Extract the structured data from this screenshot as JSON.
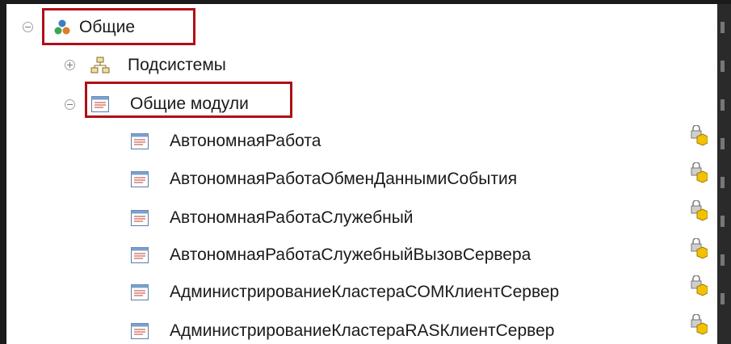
{
  "tree": {
    "root": {
      "label": "Общие",
      "icon": "common-objects-icon",
      "expander": "collapse"
    },
    "subsystems": {
      "label": "Подсистемы",
      "icon": "subsystems-icon",
      "expander": "expand"
    },
    "common_modules": {
      "label": "Общие модули",
      "icon": "module-icon",
      "expander": "collapse"
    },
    "modules": [
      {
        "label": "АвтономнаяРабота"
      },
      {
        "label": "АвтономнаяРаботаОбменДаннымиСобытия"
      },
      {
        "label": "АвтономнаяРаботаСлужебный"
      },
      {
        "label": "АвтономнаяРаботаСлужебныйВызовСервера"
      },
      {
        "label": "АдминистрированиеКластераCOMКлиентСервер"
      },
      {
        "label": "АдминистрированиеКластераRASКлиентСервер"
      }
    ]
  },
  "colors": {
    "highlight": "#b00e16",
    "background": "#ffffff",
    "frame": "#1b1b1b"
  }
}
